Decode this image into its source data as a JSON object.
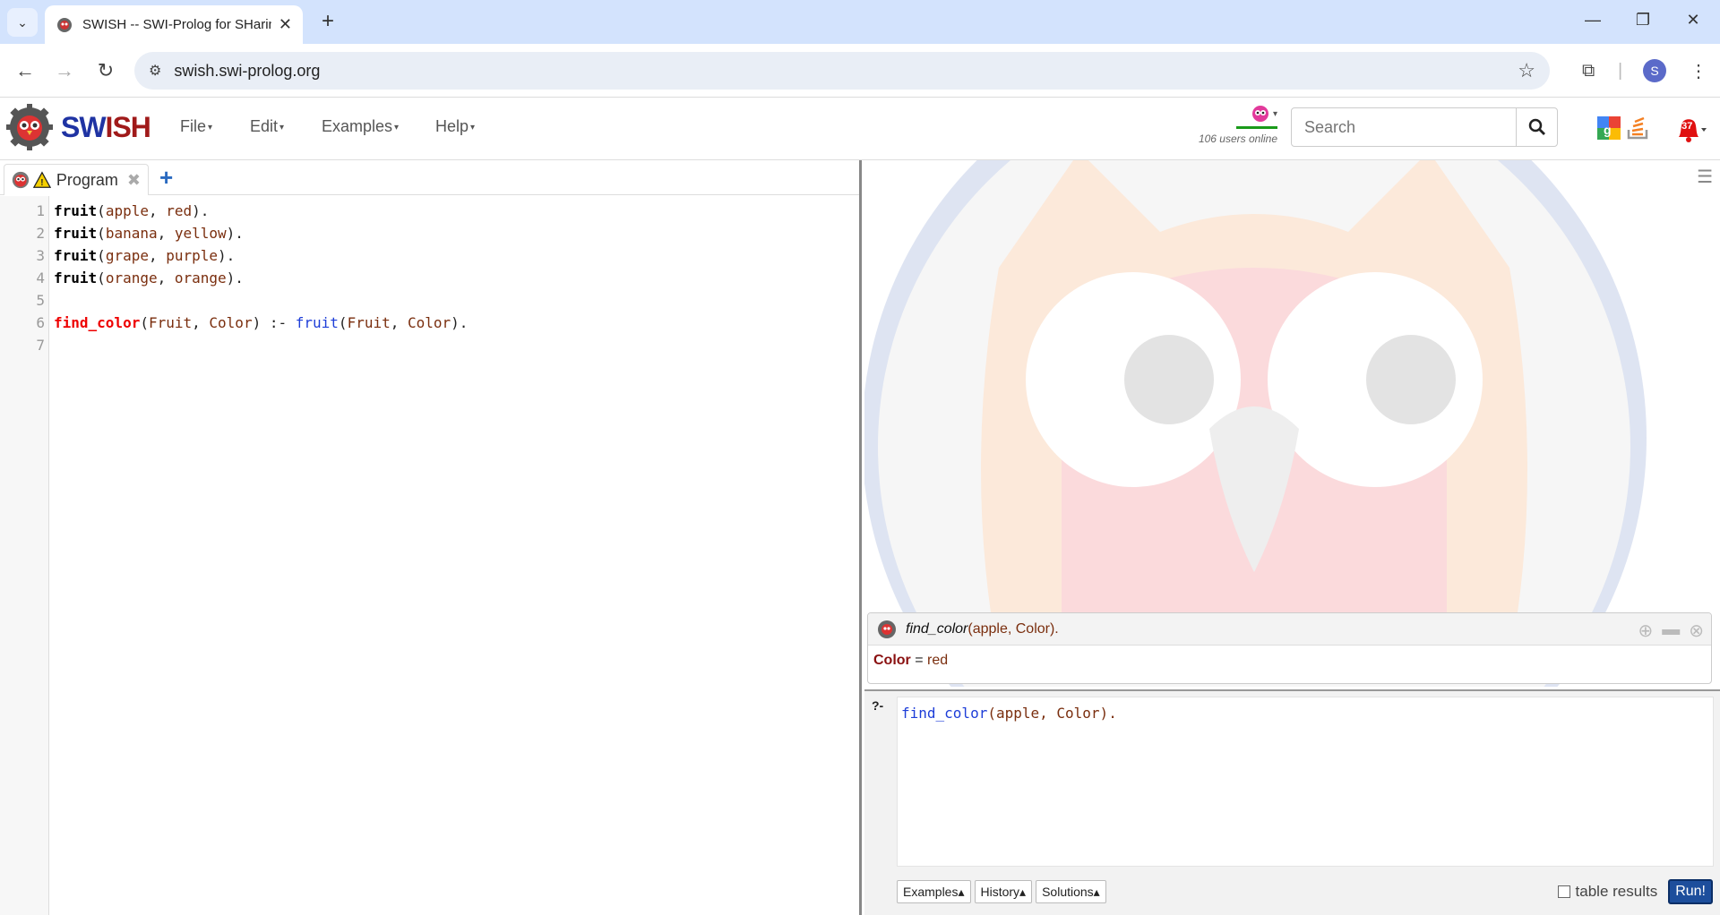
{
  "browser": {
    "tab_title": "SWISH -- SWI-Prolog for SHaring",
    "url": "swish.swi-prolog.org",
    "profile_initial": "S"
  },
  "app": {
    "brand_sw": "SW",
    "brand_ish": "ISH",
    "menus": [
      "File",
      "Edit",
      "Examples",
      "Help"
    ],
    "users_online": "106 users online",
    "search_placeholder": "Search",
    "notification_count": "037"
  },
  "editor": {
    "tab_label": "Program",
    "lines": [
      {
        "n": "1",
        "html": "<span class='f-head'>fruit</span><span class='punc'>(</span><span class='atom'>apple</span><span class='punc'>, </span><span class='atom'>red</span><span class='punc'>).</span>"
      },
      {
        "n": "2",
        "html": "<span class='f-head'>fruit</span><span class='punc'>(</span><span class='atom'>banana</span><span class='punc'>, </span><span class='atom'>yellow</span><span class='punc'>).</span>"
      },
      {
        "n": "3",
        "html": "<span class='f-head'>fruit</span><span class='punc'>(</span><span class='atom'>grape</span><span class='punc'>, </span><span class='atom'>purple</span><span class='punc'>).</span>"
      },
      {
        "n": "4",
        "html": "<span class='f-head'>fruit</span><span class='punc'>(</span><span class='atom'>orange</span><span class='punc'>, </span><span class='atom'>orange</span><span class='punc'>).</span>"
      },
      {
        "n": "5",
        "html": ""
      },
      {
        "n": "6",
        "html": "<span class='f-def'>find_color</span><span class='punc'>(</span><span class='var'>Fruit</span><span class='punc'>, </span><span class='var'>Color</span><span class='punc'>) :- </span><span class='f-call'>fruit</span><span class='punc'>(</span><span class='var'>Fruit</span><span class='punc'>, </span><span class='var'>Color</span><span class='punc'>).</span>"
      },
      {
        "n": "7",
        "html": ""
      }
    ]
  },
  "answer": {
    "query_fn": "find_color",
    "query_args": "(apple, Color).",
    "var": "Color",
    "eq": " = ",
    "value": "red"
  },
  "query": {
    "prompt": "?-",
    "fn": "find_color",
    "args": "(apple, Color).",
    "buttons": [
      "Examples▴",
      "History▴",
      "Solutions▴"
    ],
    "table_results_label": "table results",
    "run_label": "Run!"
  }
}
